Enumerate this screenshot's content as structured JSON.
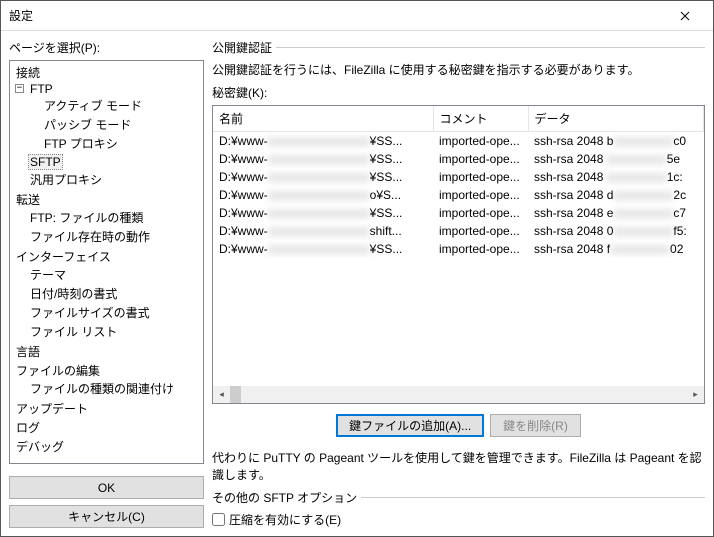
{
  "window": {
    "title": "設定"
  },
  "left": {
    "page_select_label": "ページを選択(P):",
    "ok": "OK",
    "cancel": "キャンセル(C)",
    "tree": {
      "connection": "接続",
      "ftp": "FTP",
      "active_mode": "アクティブ モード",
      "passive_mode": "パッシブ モード",
      "ftp_proxy": "FTP プロキシ",
      "sftp": "SFTP",
      "generic_proxy": "汎用プロキシ",
      "transfer": "転送",
      "ftp_filetypes": "FTP: ファイルの種類",
      "file_exists": "ファイル存在時の動作",
      "interface": "インターフェイス",
      "theme": "テーマ",
      "datetime_fmt": "日付/時刻の書式",
      "filesize_fmt": "ファイルサイズの書式",
      "file_list": "ファイル リスト",
      "language": "言語",
      "file_editing": "ファイルの編集",
      "filetype_assoc": "ファイルの種類の関連付け",
      "update": "アップデート",
      "log": "ログ",
      "debug": "デバッグ"
    }
  },
  "right": {
    "section": "公開鍵認証",
    "desc": "公開鍵認証を行うには、FileZilla に使用する秘密鍵を指示する必要があります。",
    "secret_label": "秘密鍵(K):",
    "cols": {
      "name": "名前",
      "comment": "コメント",
      "data": "データ"
    },
    "rows": [
      {
        "name_pre": "D:¥www-",
        "name_suf": "¥SS...",
        "comment": "imported-ope...",
        "data_pre": "ssh-rsa 2048 b",
        "data_suf": "c0"
      },
      {
        "name_pre": "D:¥www-",
        "name_suf": "¥SS...",
        "comment": "imported-ope...",
        "data_pre": "ssh-rsa 2048 ",
        "data_suf": "5e"
      },
      {
        "name_pre": "D:¥www-",
        "name_suf": "¥SS...",
        "comment": "imported-ope...",
        "data_pre": "ssh-rsa 2048 ",
        "data_suf": "1c:"
      },
      {
        "name_pre": "D:¥www-",
        "name_suf": "o¥S...",
        "comment": "imported-ope...",
        "data_pre": "ssh-rsa 2048 d",
        "data_suf": "2c"
      },
      {
        "name_pre": "D:¥www-",
        "name_suf": "¥SS...",
        "comment": "imported-ope...",
        "data_pre": "ssh-rsa 2048 e",
        "data_suf": "c7"
      },
      {
        "name_pre": "D:¥www-",
        "name_suf": "shift...",
        "comment": "imported-ope...",
        "data_pre": "ssh-rsa 2048 0",
        "data_suf": "f5:"
      },
      {
        "name_pre": "D:¥www-",
        "name_suf": "¥SS...",
        "comment": "imported-ope...",
        "data_pre": "ssh-rsa 2048 f",
        "data_suf": "02"
      }
    ],
    "add_key": "鍵ファイルの追加(A)...",
    "del_key": "鍵を削除(R)",
    "pageant": "代わりに PuTTY の Pageant ツールを使用して鍵を管理できます。FileZilla は Pageant を認識します。",
    "other_section": "その他の SFTP オプション",
    "compress": "圧縮を有効にする(E)"
  }
}
